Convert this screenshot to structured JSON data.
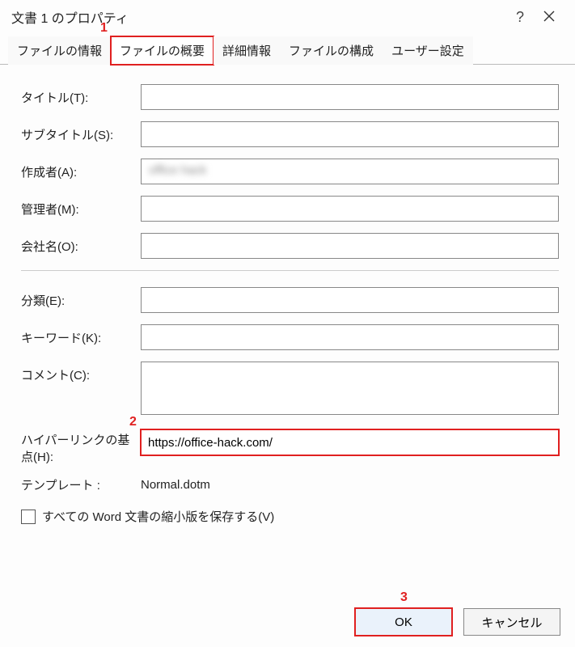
{
  "window": {
    "title": "文書 1 のプロパティ",
    "help_tooltip": "?",
    "close_tooltip": "×"
  },
  "tabs": {
    "t0": "ファイルの情報",
    "t1": "ファイルの概要",
    "t2": "詳細情報",
    "t3": "ファイルの構成",
    "t4": "ユーザー設定"
  },
  "markers": {
    "m1": "1",
    "m2": "2",
    "m3": "3"
  },
  "labels": {
    "title": "タイトル(T):",
    "subtitle": "サブタイトル(S):",
    "author": "作成者(A):",
    "manager": "管理者(M):",
    "company": "会社名(O):",
    "category": "分類(E):",
    "keywords": "キーワード(K):",
    "comment": "コメント(C):",
    "hyperlink": "ハイパーリンクの基点(H):",
    "template": "テンプレート :",
    "saveThumb": "すべての Word 文書の縮小版を保存する(V)"
  },
  "values": {
    "title": "",
    "subtitle": "",
    "author_blurred": "office hack",
    "manager": "",
    "company": "",
    "category": "",
    "keywords": "",
    "comment": "",
    "hyperlink": "https://office-hack.com/",
    "template": "Normal.dotm"
  },
  "buttons": {
    "ok": "OK",
    "cancel": "キャンセル"
  }
}
